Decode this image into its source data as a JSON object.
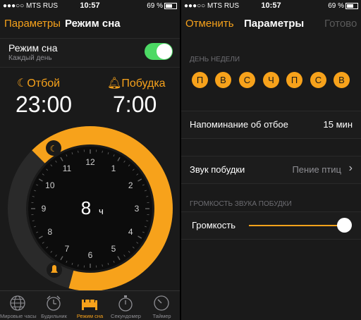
{
  "status": {
    "carrier": "MTS RUS",
    "time": "10:57",
    "battery": "69 %"
  },
  "left": {
    "nav": {
      "back": "Параметры",
      "title": "Режим сна"
    },
    "sleep_mode": {
      "title": "Режим сна",
      "subtitle": "Каждый день",
      "enabled": true
    },
    "bedtime": {
      "label": "Отбой",
      "value": "23:00"
    },
    "wakeup": {
      "label": "Побудка",
      "value": "7:00"
    },
    "clock": {
      "numbers": [
        "12",
        "1",
        "2",
        "3",
        "4",
        "5",
        "6",
        "7",
        "8",
        "9",
        "10",
        "11"
      ],
      "duration": "8",
      "duration_unit": "ч"
    },
    "tabs": [
      {
        "label": "Мировые часы",
        "icon": "globe-icon"
      },
      {
        "label": "Будильник",
        "icon": "alarm-clock-icon"
      },
      {
        "label": "Режим сна",
        "icon": "bed-icon",
        "active": true
      },
      {
        "label": "Секундомер",
        "icon": "stopwatch-icon"
      },
      {
        "label": "Таймер",
        "icon": "timer-icon"
      }
    ]
  },
  "right": {
    "nav": {
      "cancel": "Отменить",
      "title": "Параметры",
      "done": "Готово"
    },
    "weekday_header": "ДЕНЬ НЕДЕЛИ",
    "days": [
      "П",
      "В",
      "С",
      "Ч",
      "П",
      "С",
      "В"
    ],
    "reminder": {
      "label": "Напоминание об отбое",
      "value": "15 мин"
    },
    "sound": {
      "label": "Звук побудки",
      "value": "Пение птиц"
    },
    "volume_header": "ГРОМКОСТЬ ЗВУКА ПОБУДКИ",
    "volume": {
      "label": "Громкость",
      "level": 1.0
    }
  },
  "colors": {
    "accent": "#f7a21b",
    "switch_on": "#4cd964",
    "background": "#1a1a1a",
    "disabled": "#5a5a5a"
  }
}
